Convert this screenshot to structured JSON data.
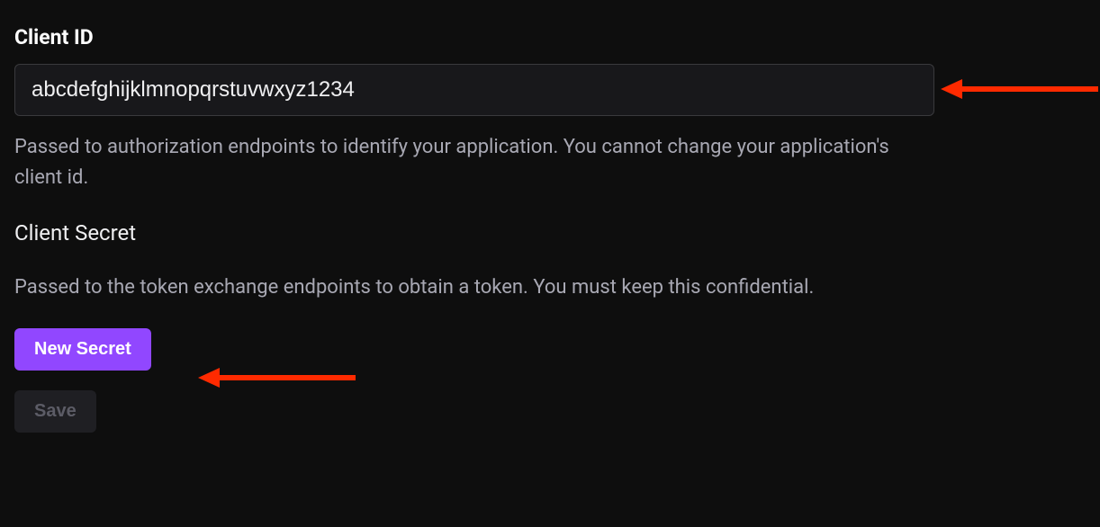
{
  "form": {
    "client_id": {
      "label": "Client ID",
      "value": "abcdefghijklmnopqrstuvwxyz1234",
      "help": "Passed to authorization endpoints to identify your application. You cannot change your application's client id."
    },
    "client_secret": {
      "heading": "Client Secret",
      "help": "Passed to the token exchange endpoints to obtain a token. You must keep this confidential.",
      "new_secret_label": "New Secret"
    },
    "save_label": "Save"
  },
  "annotations": {
    "arrow_color": "#ff2a00"
  }
}
